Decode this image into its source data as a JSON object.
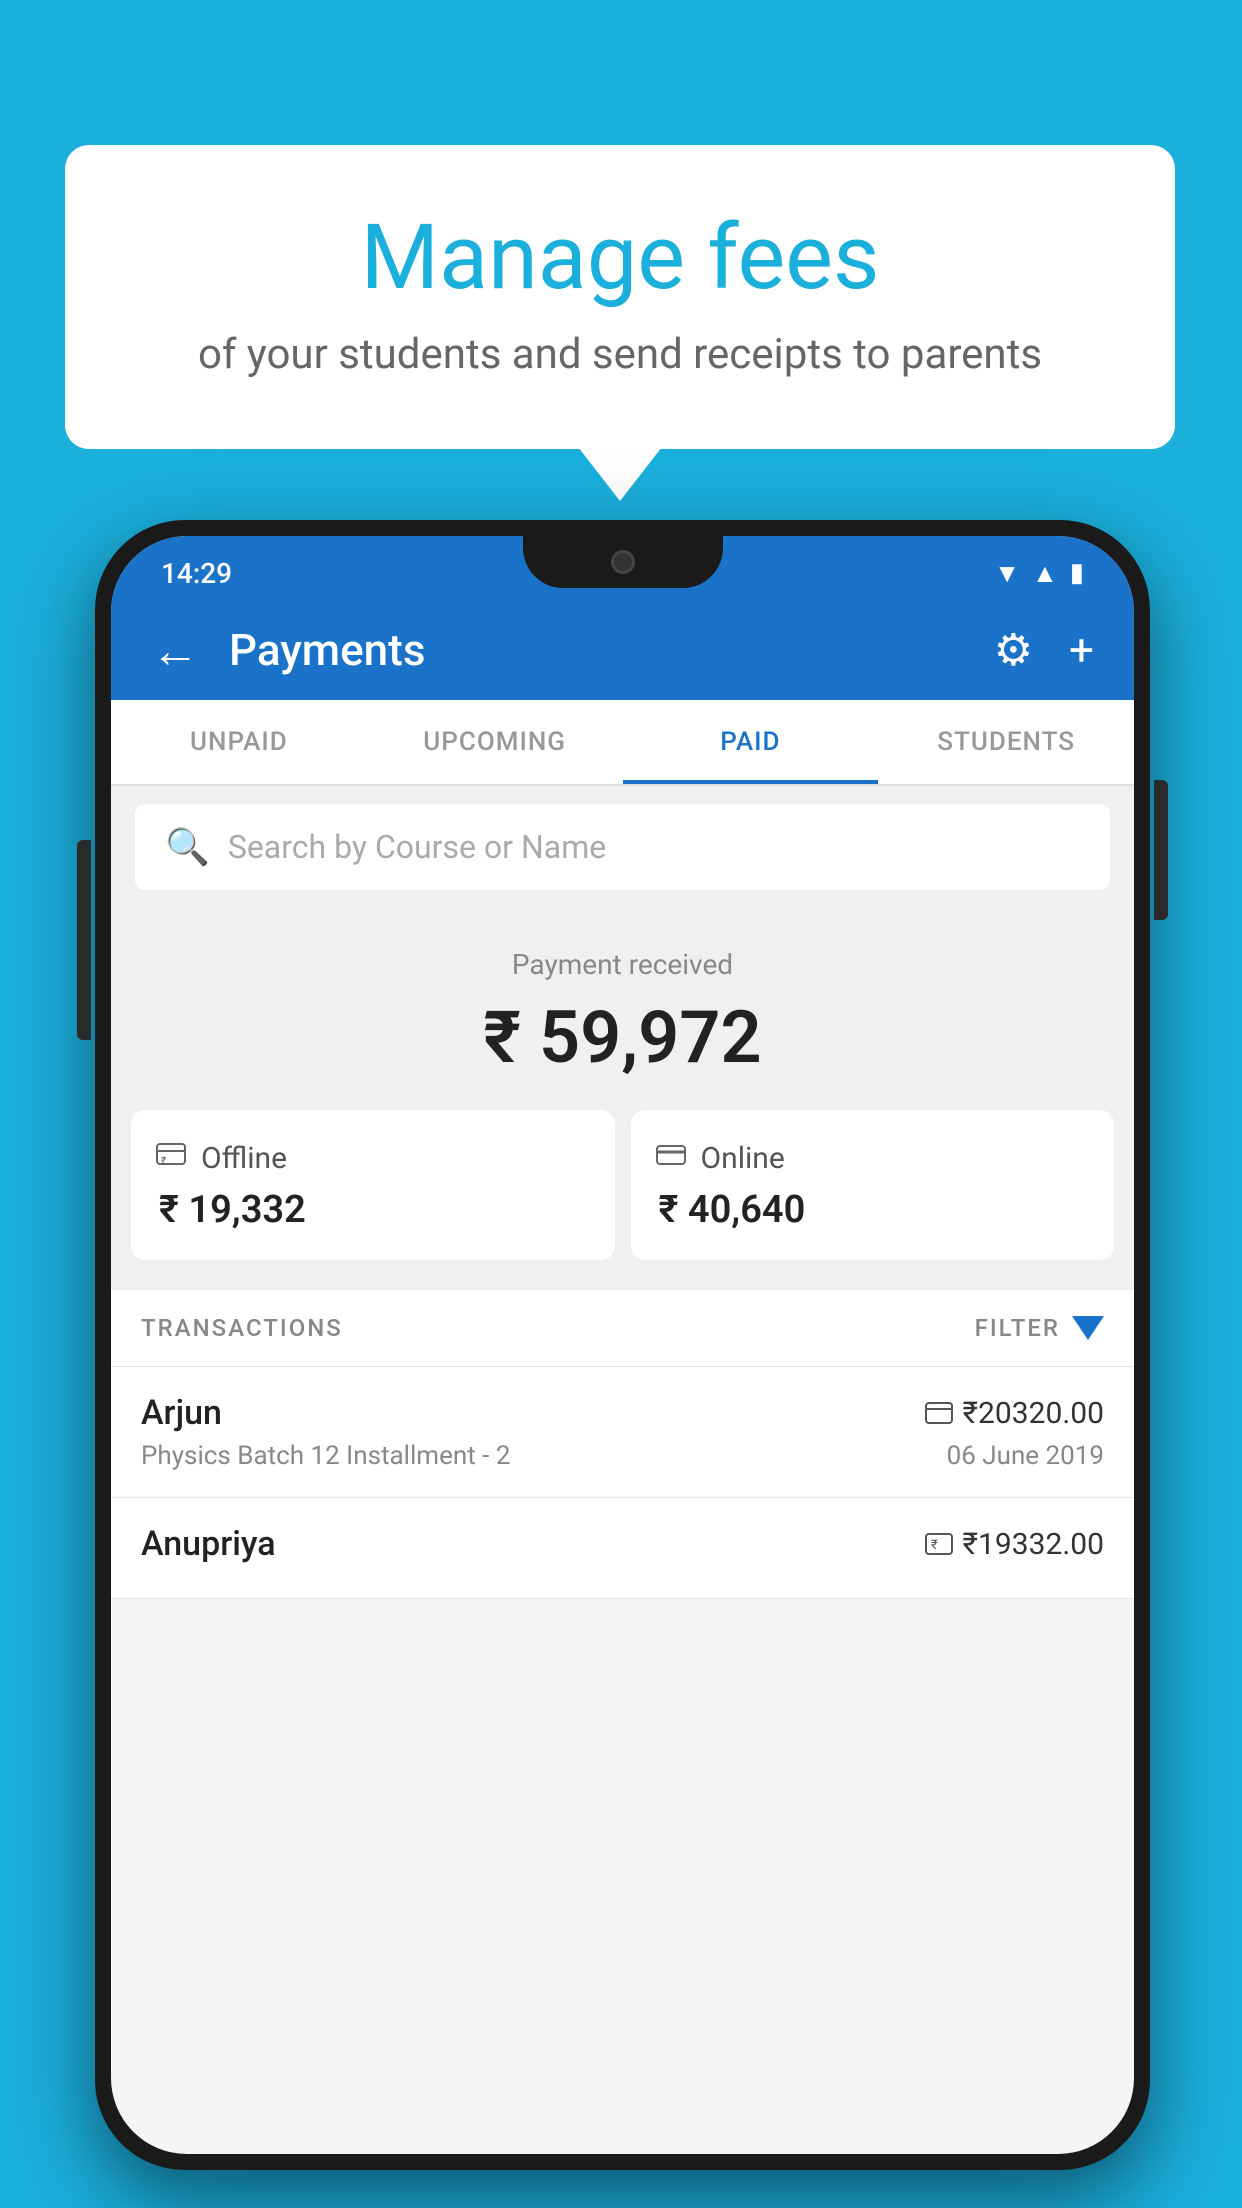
{
  "background_color": "#1BAFDC",
  "speech_bubble": {
    "title": "Manage fees",
    "subtitle": "of your students and send receipts to parents"
  },
  "status_bar": {
    "time": "14:29",
    "icons": [
      "wifi",
      "signal",
      "battery"
    ]
  },
  "nav": {
    "title": "Payments",
    "back_label": "←",
    "settings_label": "⚙",
    "add_label": "+"
  },
  "tabs": [
    {
      "label": "UNPAID",
      "active": false
    },
    {
      "label": "UPCOMING",
      "active": false
    },
    {
      "label": "PAID",
      "active": true
    },
    {
      "label": "STUDENTS",
      "active": false
    }
  ],
  "search": {
    "placeholder": "Search by Course or Name"
  },
  "payment_received": {
    "label": "Payment received",
    "amount": "₹ 59,972"
  },
  "payment_cards": [
    {
      "type": "Offline",
      "amount": "₹ 19,332",
      "icon": "rupee-box"
    },
    {
      "type": "Online",
      "amount": "₹ 40,640",
      "icon": "card"
    }
  ],
  "transactions_header": {
    "label": "TRANSACTIONS",
    "filter_label": "FILTER"
  },
  "transactions": [
    {
      "name": "Arjun",
      "course": "Physics Batch 12 Installment - 2",
      "amount": "₹20320.00",
      "date": "06 June 2019",
      "payment_type": "card"
    },
    {
      "name": "Anupriya",
      "course": "",
      "amount": "₹19332.00",
      "date": "",
      "payment_type": "cash"
    }
  ]
}
